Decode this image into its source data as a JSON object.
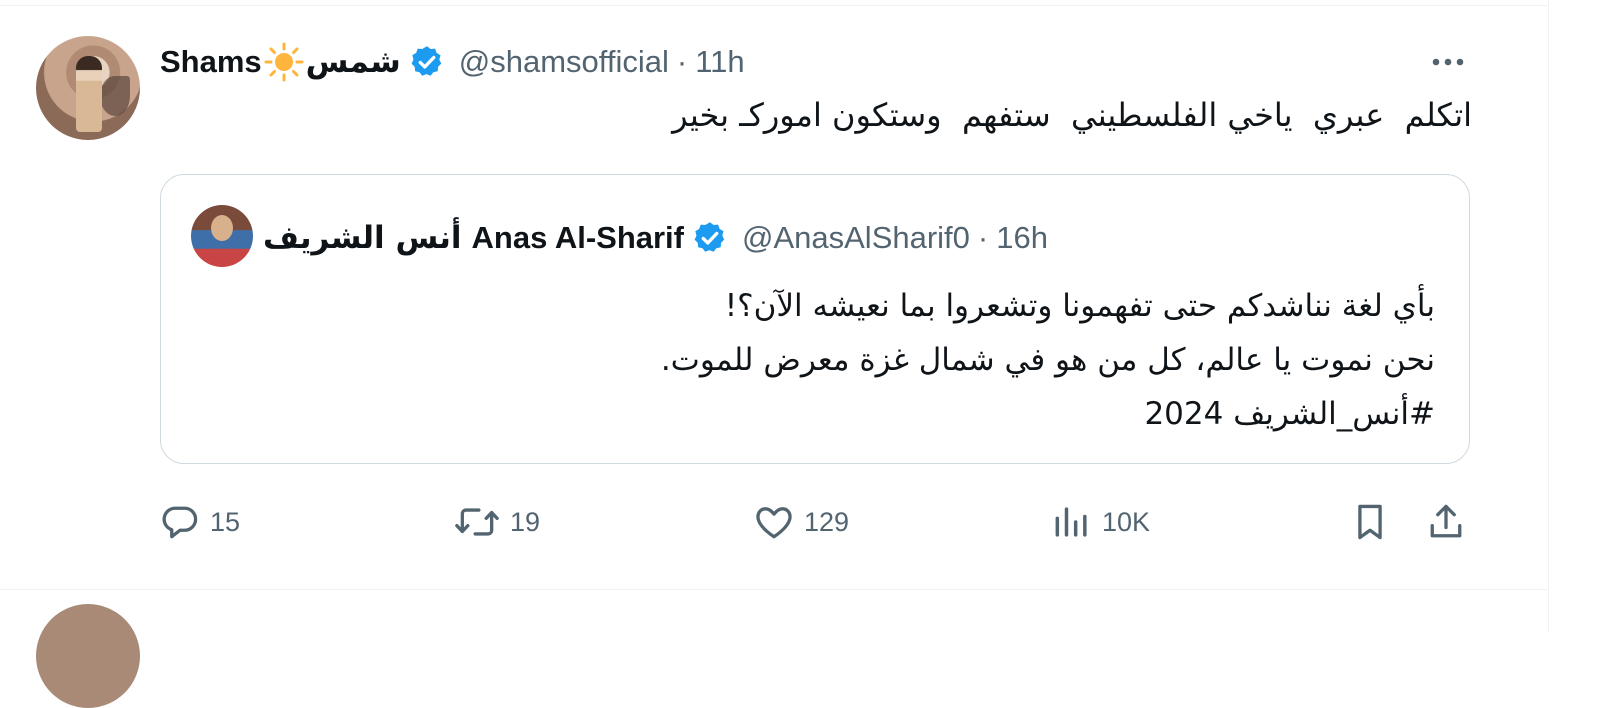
{
  "tweet": {
    "author_name": "Shams",
    "author_name_ar": "شمس",
    "handle": "@shamsofficial",
    "separator": "·",
    "time": "11h",
    "text": "اتكلم  عبري  ياخي الفلسطيني  ستفهم  وستكون اموركـ بخير",
    "icons": {
      "more": "more-icon",
      "sun": "sun-emoji-icon",
      "verified": "verified-badge-icon"
    }
  },
  "quote": {
    "author_name_ar": "أنس الشريف",
    "author_name": "Anas Al-Sharif",
    "handle": "@AnasAlSharif0",
    "separator": "·",
    "time": "16h",
    "lines": [
      "بأي لغة نناشدكم حتى تفهمونا وتشعروا بما نعيشه الآن؟!",
      "نحن نموت يا عالم، كل من هو في شمال غزة معرض للموت.",
      "#أنس_الشريف 2024"
    ]
  },
  "actions": {
    "replies": "15",
    "retweets": "19",
    "likes": "129",
    "views": "10K",
    "icons": [
      "reply-icon",
      "retweet-icon",
      "like-icon",
      "views-icon",
      "bookmark-icon",
      "share-icon"
    ]
  },
  "colors": {
    "text": "#0f1419",
    "secondary": "#536471",
    "verified": "#1d9bf0",
    "border": "#cfd9de",
    "sun": "#ffb43c"
  }
}
